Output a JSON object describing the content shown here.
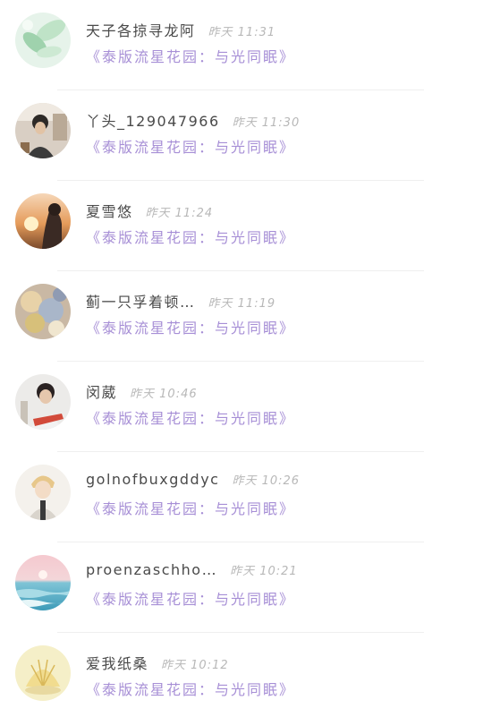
{
  "conversations": [
    {
      "name": "天子各掠寻龙阿",
      "time": "昨天 11:31",
      "message": "《泰版流星花园：与光同眠》",
      "avatar_icon": "leaf-avatar-icon"
    },
    {
      "name": "丫头_129047966",
      "time": "昨天 11:30",
      "message": "《泰版流星花园：与光同眠》",
      "avatar_icon": "person-avatar-icon"
    },
    {
      "name": "夏雪悠",
      "time": "昨天 11:24",
      "message": "《泰版流星花园：与光同眠》",
      "avatar_icon": "sunset-avatar-icon"
    },
    {
      "name": "蓟一只孚着顿…",
      "time": "昨天 11:19",
      "message": "《泰版流星花园：与光同眠》",
      "avatar_icon": "flowers-avatar-icon"
    },
    {
      "name": "闵葳",
      "time": "昨天 10:46",
      "message": "《泰版流星花园：与光同眠》",
      "avatar_icon": "man-avatar-icon"
    },
    {
      "name": "golnofbuxgddyc",
      "time": "昨天 10:26",
      "message": "《泰版流星花园：与光同眠》",
      "avatar_icon": "anime-avatar-icon"
    },
    {
      "name": "proenzaschho…",
      "time": "昨天 10:21",
      "message": "《泰版流星花园：与光同眠》",
      "avatar_icon": "sea-avatar-icon"
    },
    {
      "name": "爱我纸桑",
      "time": "昨天 10:12",
      "message": "《泰版流星花园：与光同眠》",
      "avatar_icon": "shell-avatar-icon"
    }
  ]
}
